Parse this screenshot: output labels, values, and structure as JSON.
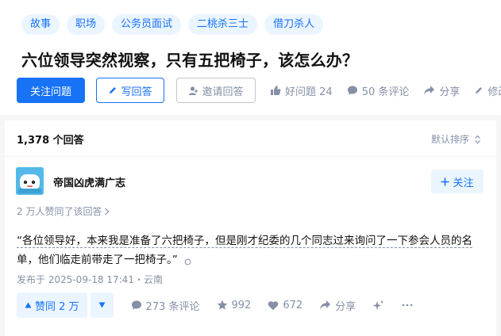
{
  "question": {
    "topics": [
      "故事",
      "职场",
      "公务员面试",
      "二桃杀三士",
      "借刀杀人"
    ],
    "title": "六位领导突然视察，只有五把椅子，该怎么办？",
    "actions": {
      "follow": "关注问题",
      "write": "写回答",
      "invite": "邀请回答",
      "good_question": "好问题 24",
      "comments": "50 条评论",
      "share": "分享",
      "edit": "修改"
    }
  },
  "answers": {
    "count": "1,378 个回答",
    "sort_label": "默认排序"
  },
  "answer": {
    "author": "帝国凶虎满广志",
    "follow": "关注",
    "upvote_summary": "2 万人赞同了该回答",
    "content_line1": "“各位领导好，本来我是准备了六把椅子，但是刚才纪委的几个同志过来询问了一下参会人员的名",
    "content_line2": "单，他们临走前带走了一把椅子。”",
    "publish": "发布于 2025-09-18 17:41・云南",
    "vote_up": "赞同 2 万",
    "comments": "273 条评论",
    "favorites": "992",
    "likes": "672",
    "share": "分享"
  },
  "colors": {
    "accent": "#1772f6",
    "accent_bg": "#ebf5ff",
    "muted": "#8590a6"
  }
}
